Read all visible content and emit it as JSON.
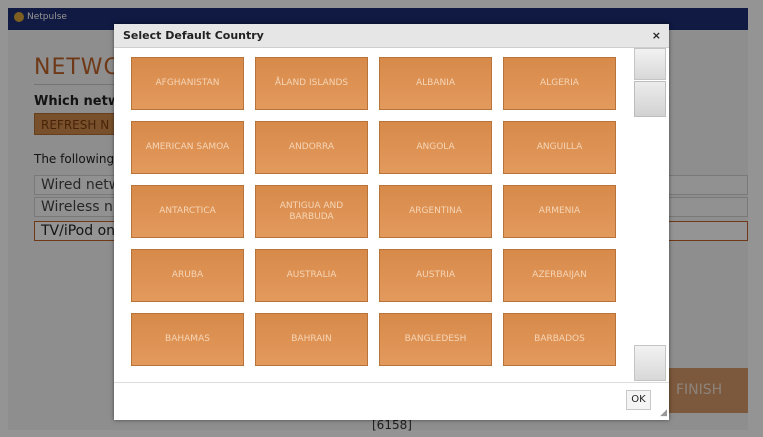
{
  "app": {
    "brand": "Netpulse"
  },
  "page": {
    "title": "NETWO",
    "question": "Which netw",
    "refresh_label": "REFRESH N",
    "following_text": "The following",
    "networks": [
      "Wired netw",
      "Wireless n",
      "TV/iPod on"
    ],
    "finish_label": "FINISH",
    "footer_text": "[6158]"
  },
  "dialog": {
    "title": "Select Default Country",
    "close_label": "×",
    "ok_label": "OK",
    "countries": [
      "AFGHANISTAN",
      "ÅLAND ISLANDS",
      "ALBANIA",
      "ALGERIA",
      "AMERICAN SAMOA",
      "ANDORRA",
      "ANGOLA",
      "ANGUILLA",
      "ANTARCTICA",
      "ANTIGUA AND BARBUDA",
      "ARGENTINA",
      "ARMENIA",
      "ARUBA",
      "AUSTRALIA",
      "AUSTRIA",
      "AZERBAIJAN",
      "BAHAMAS",
      "BAHRAIN",
      "BANGLEDESH",
      "BARBADOS"
    ]
  }
}
